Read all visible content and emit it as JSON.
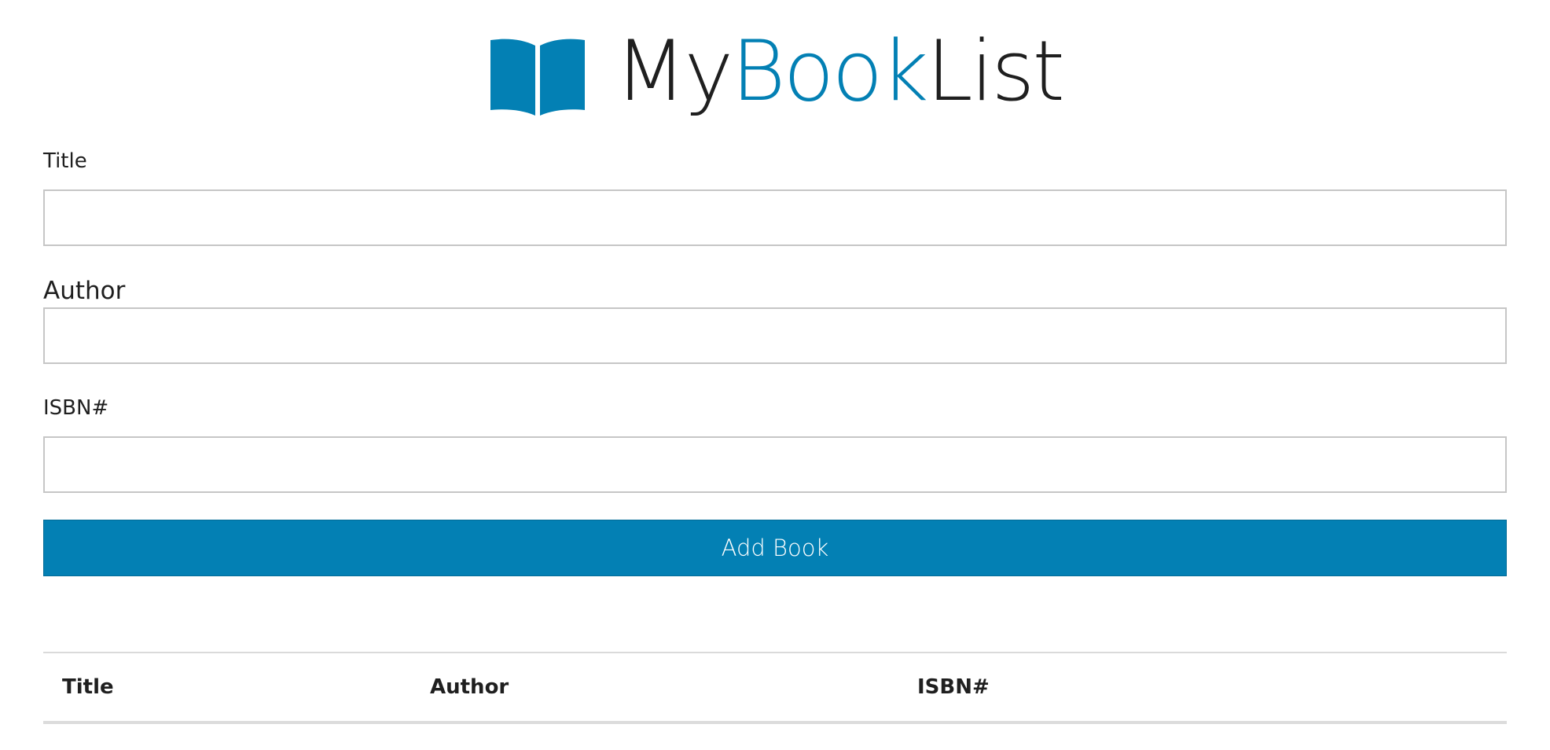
{
  "header": {
    "brand_part1": "My",
    "brand_part2": "Book",
    "brand_part3": "List",
    "icon": "book-open-icon",
    "accent_color": "#0380b4"
  },
  "form": {
    "title_label": "Title",
    "title_value": "",
    "author_label": "Author",
    "author_value": "",
    "isbn_label": "ISBN#",
    "isbn_value": "",
    "submit_label": "Add Book"
  },
  "table": {
    "columns": [
      "Title",
      "Author",
      "ISBN#"
    ],
    "rows": []
  }
}
